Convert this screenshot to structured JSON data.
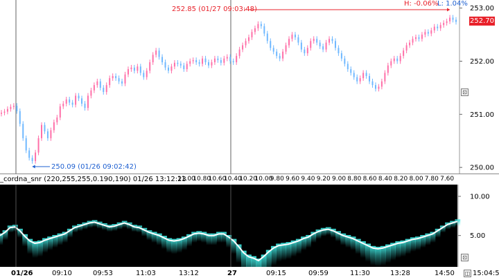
{
  "price_panel": {
    "high_label": "H: -0.06%",
    "low_label": "L: 1.04%",
    "current_price": "252.70",
    "max_annotation": "252.85 (01/27 09:03:48)",
    "min_annotation": "250.09 (01/26 09:02:42)",
    "colors": {
      "up_candle": "#ff6fa8",
      "down_candle": "#6fb8ff",
      "annotation_red": "#e8212a",
      "annotation_blue": "#1d5fd0",
      "grid_line": "#d0d0d0",
      "separator": "#606060"
    }
  },
  "indicator_panel": {
    "title": "_cordna_snr (220,255,255,0.190,190) 01/26 13:12:23",
    "period_labels": [
      "11.00",
      "10.80",
      "10.60",
      "10.40",
      "10.20",
      "10.00",
      "9.80",
      "9.60",
      "9.40",
      "9.20",
      "9.00",
      "8.80",
      "8.60",
      "8.40",
      "8.20",
      "8.00",
      "7.80",
      "7.60"
    ],
    "axis_ticks": [
      "10.00",
      "5.00"
    ],
    "colors": {
      "background": "#000000",
      "heat": "#3fe6e0",
      "line": "#ffffff"
    }
  },
  "time_axis": {
    "labels": [
      "01/26",
      "09:10",
      "09:53",
      "11:03",
      "13:12",
      "27",
      "09:15",
      "09:59",
      "11:30",
      "13:28",
      "14:50"
    ],
    "clock": "15:04:57"
  },
  "controls": {
    "corner_button_top": "⊡",
    "corner_button_bottom": "⊡",
    "corner_button_timeaxis": "◫"
  },
  "chart_data": [
    {
      "type": "candlestick",
      "y_axis_ticks": [
        "253.00",
        "252.00",
        "251.00",
        "250.00"
      ],
      "ylim": [
        249.95,
        253.1
      ],
      "session_separators": [
        "01/26",
        "27"
      ],
      "series": [
        {
          "close": [
            251.03,
            251.05,
            251.1,
            251.14,
            251.16,
            251.06,
            250.82,
            250.55,
            250.32,
            250.18,
            250.12,
            250.28,
            250.55,
            250.8,
            250.68,
            250.55,
            250.7,
            250.85,
            250.94,
            251.15,
            251.2,
            251.28,
            251.22,
            251.18,
            251.35,
            251.3,
            251.2,
            251.12,
            251.35,
            251.45,
            251.55,
            251.62,
            251.5,
            251.42,
            251.55,
            251.68,
            251.72,
            251.68,
            251.62,
            251.58,
            251.75,
            251.85,
            251.88,
            251.82,
            251.9,
            251.78,
            251.7,
            251.82,
            251.98,
            252.12,
            252.2,
            252.08,
            251.98,
            251.88,
            251.82,
            251.9,
            251.97,
            251.95,
            251.92,
            251.85,
            251.95,
            252.0,
            252.02,
            251.98,
            251.95,
            252.05,
            251.98,
            251.92,
            251.98,
            252.05,
            252.02,
            251.97,
            252.05,
            252.08,
            252.0,
            251.98,
            252.1,
            252.22,
            252.3,
            252.38,
            252.45,
            252.55,
            252.62,
            252.7,
            252.66,
            252.52,
            252.38,
            252.25,
            252.18,
            252.1,
            252.05,
            252.18,
            252.3,
            252.42,
            252.5,
            252.45,
            252.35,
            252.22,
            252.15,
            252.25,
            252.38,
            252.42,
            252.35,
            252.28,
            252.22,
            252.35,
            252.42,
            252.38,
            252.25,
            252.15,
            252.05,
            251.95,
            251.85,
            251.78,
            251.7,
            251.62,
            251.68,
            251.78,
            251.72,
            251.62,
            251.55,
            251.48,
            251.52,
            251.62,
            251.78,
            251.92,
            252.0,
            252.05,
            252.0,
            252.1,
            252.2,
            252.3,
            252.35,
            252.42,
            252.45,
            252.42,
            252.5,
            252.55,
            252.52,
            252.58,
            252.65,
            252.62,
            252.68,
            252.72,
            252.75,
            252.82,
            252.78,
            252.74
          ]
        }
      ]
    },
    {
      "type": "line",
      "title": "_cordna_snr",
      "yticks": [
        "10.00",
        "5.00"
      ],
      "ylim": [
        1.0,
        11.5
      ],
      "series": [
        {
          "values": [
            5.0,
            5.4,
            6.0,
            6.1,
            5.6,
            4.9,
            4.3,
            4.0,
            4.1,
            4.4,
            4.6,
            4.8,
            5.0,
            5.2,
            5.6,
            6.0,
            6.2,
            6.4,
            6.6,
            6.7,
            6.5,
            6.3,
            6.1,
            6.2,
            6.4,
            6.6,
            6.4,
            6.1,
            6.0,
            5.7,
            5.4,
            5.2,
            5.0,
            4.7,
            4.4,
            4.3,
            4.4,
            4.6,
            4.9,
            5.2,
            5.3,
            5.2,
            5.0,
            5.0,
            5.2,
            5.2,
            4.8,
            4.3,
            3.6,
            2.8,
            2.3,
            2.1,
            1.8,
            2.3,
            2.9,
            3.4,
            3.7,
            3.8,
            3.9,
            4.1,
            4.3,
            4.6,
            4.8,
            5.2,
            5.5,
            5.7,
            5.8,
            5.6,
            5.3,
            5.0,
            4.8,
            4.6,
            4.3,
            4.0,
            3.7,
            3.4,
            3.3,
            3.4,
            3.6,
            3.8,
            4.0,
            4.1,
            4.3,
            4.5,
            4.6,
            4.8,
            5.0,
            5.2,
            5.6,
            6.0,
            6.4,
            6.6,
            6.8
          ]
        }
      ]
    }
  ]
}
